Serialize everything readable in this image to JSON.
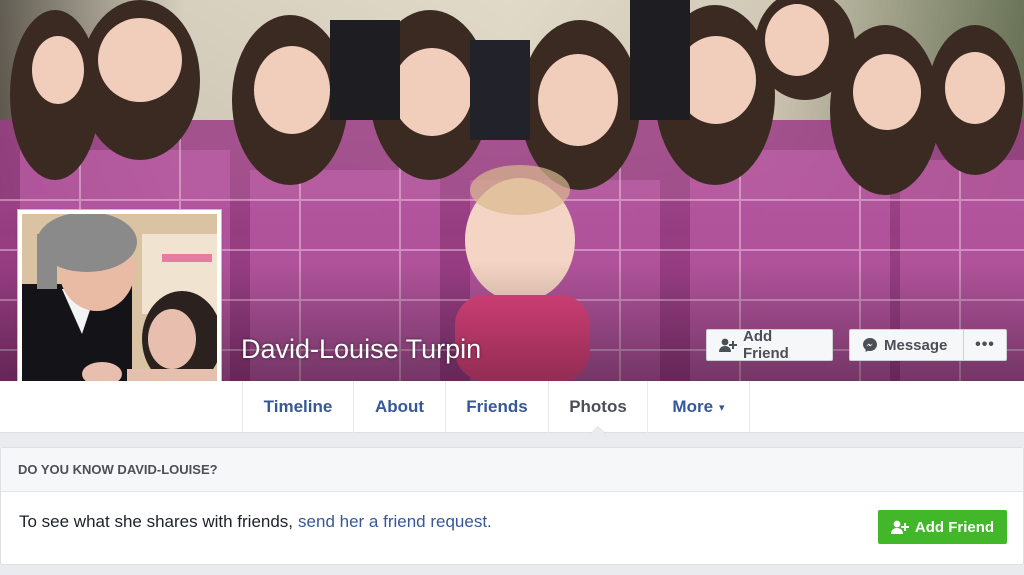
{
  "profile": {
    "name": "David-Louise Turpin"
  },
  "cover_actions": {
    "add_friend_label": "Add Friend",
    "message_label": "Message",
    "more_label": "•••"
  },
  "tabs": [
    {
      "label": "Timeline"
    },
    {
      "label": "About"
    },
    {
      "label": "Friends"
    },
    {
      "label": "Photos",
      "active": true
    },
    {
      "label": "More",
      "caret": "▾"
    }
  ],
  "know_card": {
    "title": "DO YOU KNOW DAVID-LOUISE?",
    "text": "To see what she shares with friends,",
    "link_text": "send her a friend request.",
    "button_label": "Add Friend"
  },
  "colors": {
    "link": "#365899",
    "green": "#42b72a",
    "background": "#e9ebee"
  },
  "icons": [
    "add-friend-icon",
    "messenger-icon",
    "more-dots-icon",
    "caret-down-icon"
  ]
}
